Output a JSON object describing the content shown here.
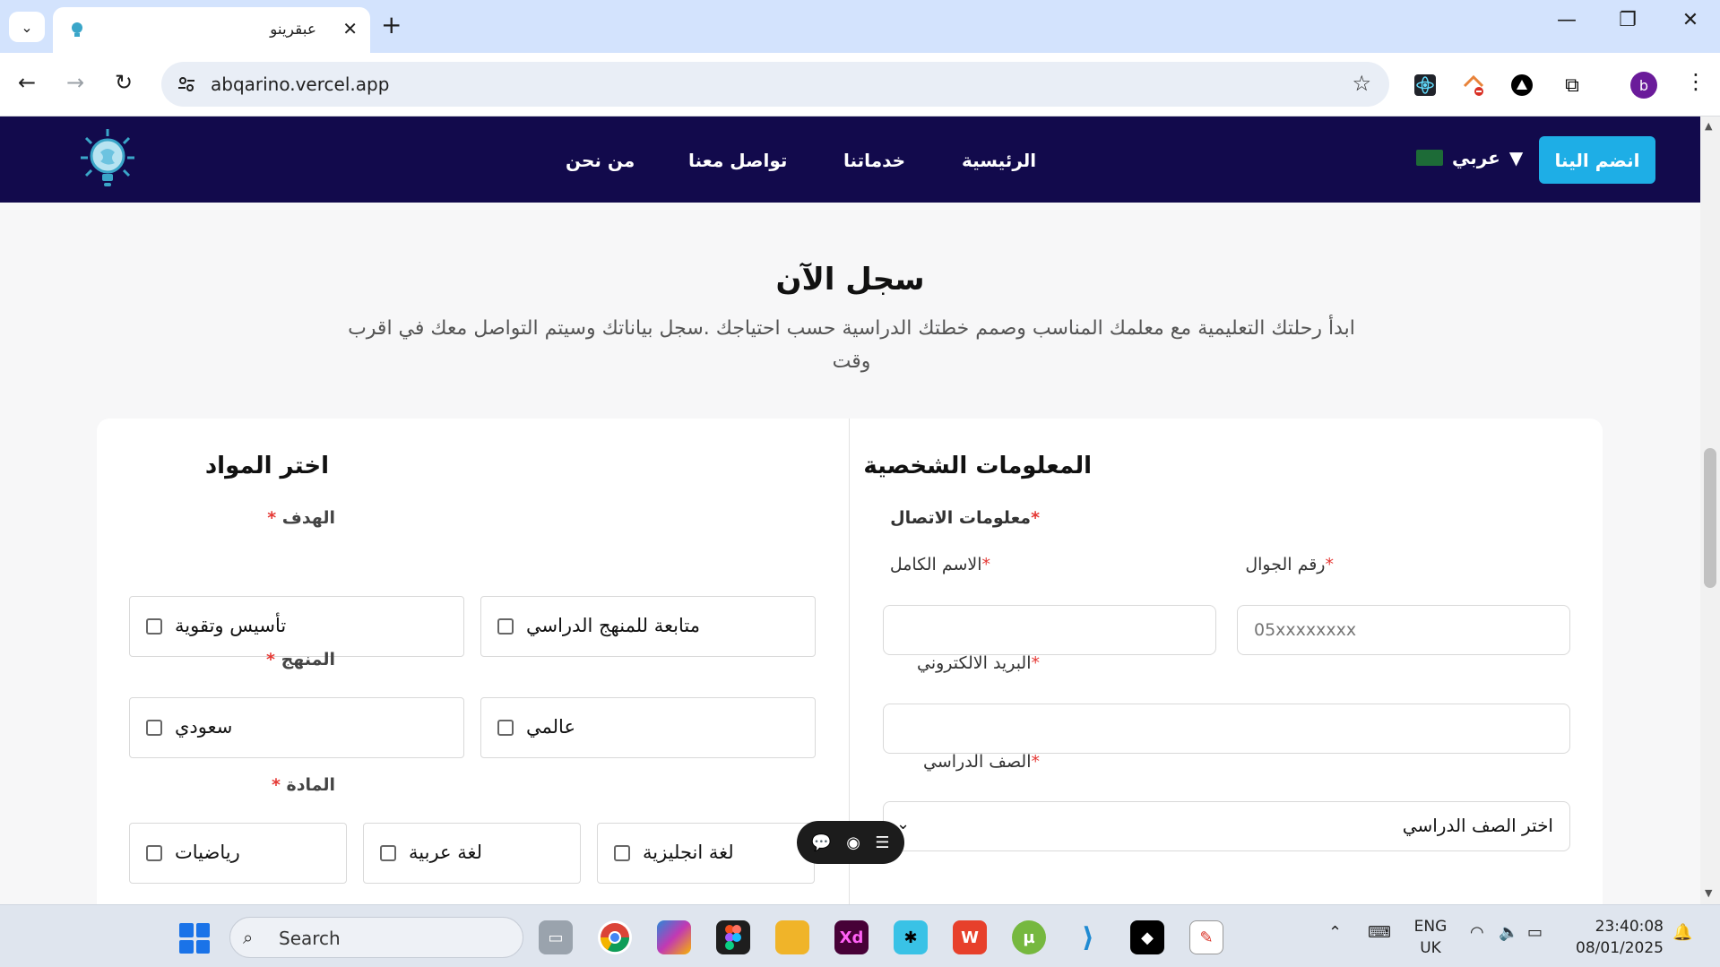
{
  "browser": {
    "tab_title": "عبقرينو",
    "url": "abqarino.vercel.app",
    "avatar_letter": "b"
  },
  "nav": {
    "links": [
      "الرئيسية",
      "خدماتنا",
      "تواصل معنا",
      "من نحن"
    ],
    "language": "عربي",
    "language_arrow": "▼",
    "join_label": "انضم الينا"
  },
  "hero": {
    "title": "سجل الآن",
    "subtitle": "ابدأ رحلتك التعليمية مع معلمك المناسب وصمم خطتك الدراسية حسب احتياجك .سجل بياناتك وسيتم التواصل معك في اقرب وقت"
  },
  "personal": {
    "title": "المعلومات الشخصية",
    "contact_label": "معلومات الاتصال",
    "full_name_label": "الاسم الكامل",
    "phone_label": "رقم الجوال",
    "phone_placeholder": "05xxxxxxxx",
    "email_label": "البريد الالكتروني",
    "grade_label": "الصف الدراسي",
    "grade_value": "اختر الصف الدراسي"
  },
  "subjects": {
    "title": "اختر المواد",
    "goal_label": "الهدف",
    "goal_options": [
      "تأسيس وتقوية",
      "متابعة للمنهج الدراسي"
    ],
    "curriculum_label": "المنهج",
    "curriculum_options": [
      "سعودي",
      "عالمي"
    ],
    "subject_label": "المادة",
    "subject_options": [
      "رياضيات",
      "لغة عربية",
      "لغة انجليزية"
    ]
  },
  "required_mark": "*",
  "taskbar": {
    "search_label": "Search",
    "lang_line1": "ENG",
    "lang_line2": "UK",
    "time": "23:40:08",
    "date": "08/01/2025"
  },
  "colors": {
    "nav_bg": "#120a4c",
    "accent": "#1eaee6",
    "required": "#e53935"
  }
}
